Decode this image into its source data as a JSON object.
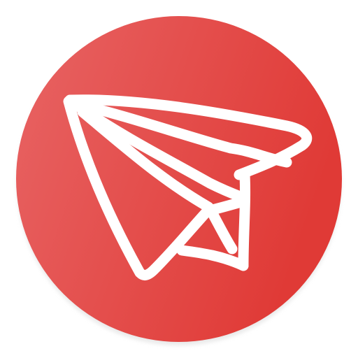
{
  "app_icon": {
    "icon_name": "paper-plane-icon",
    "style": "hand-drawn white outline on red circle",
    "colors": {
      "background_start": "#e86464",
      "background_end": "#e03a36",
      "shadow": "#d8d8d8",
      "stroke": "#ffffff",
      "page": "#ffffff"
    }
  }
}
